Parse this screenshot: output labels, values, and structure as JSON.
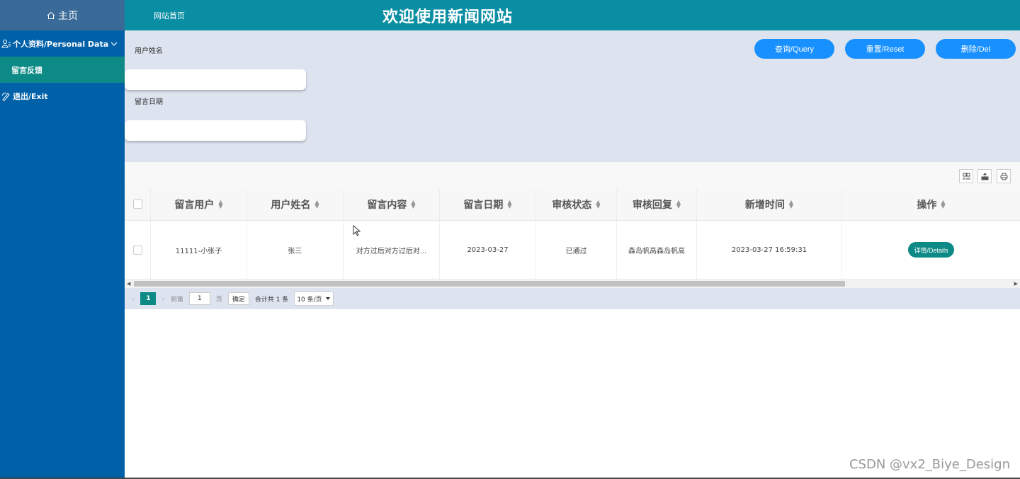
{
  "sidebar": {
    "home": "主页",
    "group_label": "个人资料/Personal Data",
    "sub_item": "留言反馈",
    "exit_label": "退出/Exit",
    "accent": "#0061a8",
    "active_color": "#0e8a86"
  },
  "header": {
    "home_link": "网站首页",
    "title": "欢迎使用新闻网站"
  },
  "search": {
    "name_label": "用户姓名",
    "name_value": "",
    "date_label": "留言日期",
    "date_value": "",
    "query_btn": "查询/Query",
    "reset_btn": "重置/Reset",
    "del_btn": "删除/Del"
  },
  "table": {
    "columns": [
      "留言用户",
      "用户姓名",
      "留言内容",
      "留言日期",
      "审核状态",
      "审核回复",
      "新增时间",
      "操作"
    ],
    "rows": [
      {
        "user": "11111-小张子",
        "name": "张三",
        "content": "对方过后对方过后对...",
        "date": "2023-03-27",
        "status": "已通过",
        "reply": "森岛帆高森岛帆高",
        "created": "2023-03-27 16:59:31",
        "action": "详情/Details"
      }
    ]
  },
  "pager": {
    "current": "1",
    "goto_label": "到第",
    "goto_value": "1",
    "page_unit": "页",
    "ok": "确定",
    "total": "合计共 1 条",
    "page_size": "10 条/页"
  },
  "watermark": "CSDN @vx2_Biye_Design"
}
